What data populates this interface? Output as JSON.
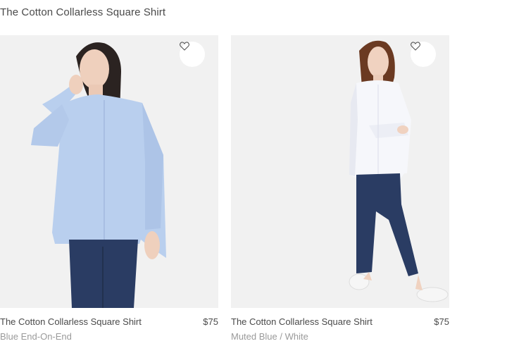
{
  "page": {
    "title": "The Cotton Collarless Square Shirt"
  },
  "products": [
    {
      "name": "The Cotton Collarless Square Shirt",
      "price": "$75",
      "color_name": "Blue End-On-End",
      "shirt_color": "#b9cfee",
      "wishlist_icon": "heart-outline-icon"
    },
    {
      "name": "The Cotton Collarless Square Shirt",
      "price": "$75",
      "color_name": "Muted Blue / White",
      "shirt_color": "#f6f7fb",
      "wishlist_icon": "heart-outline-icon"
    }
  ],
  "colors": {
    "background": "#ffffff",
    "image_background": "#f1f1f1",
    "denim": "#2a3c63",
    "text": "#4a4a4a",
    "muted_text": "#9a9a9a"
  }
}
